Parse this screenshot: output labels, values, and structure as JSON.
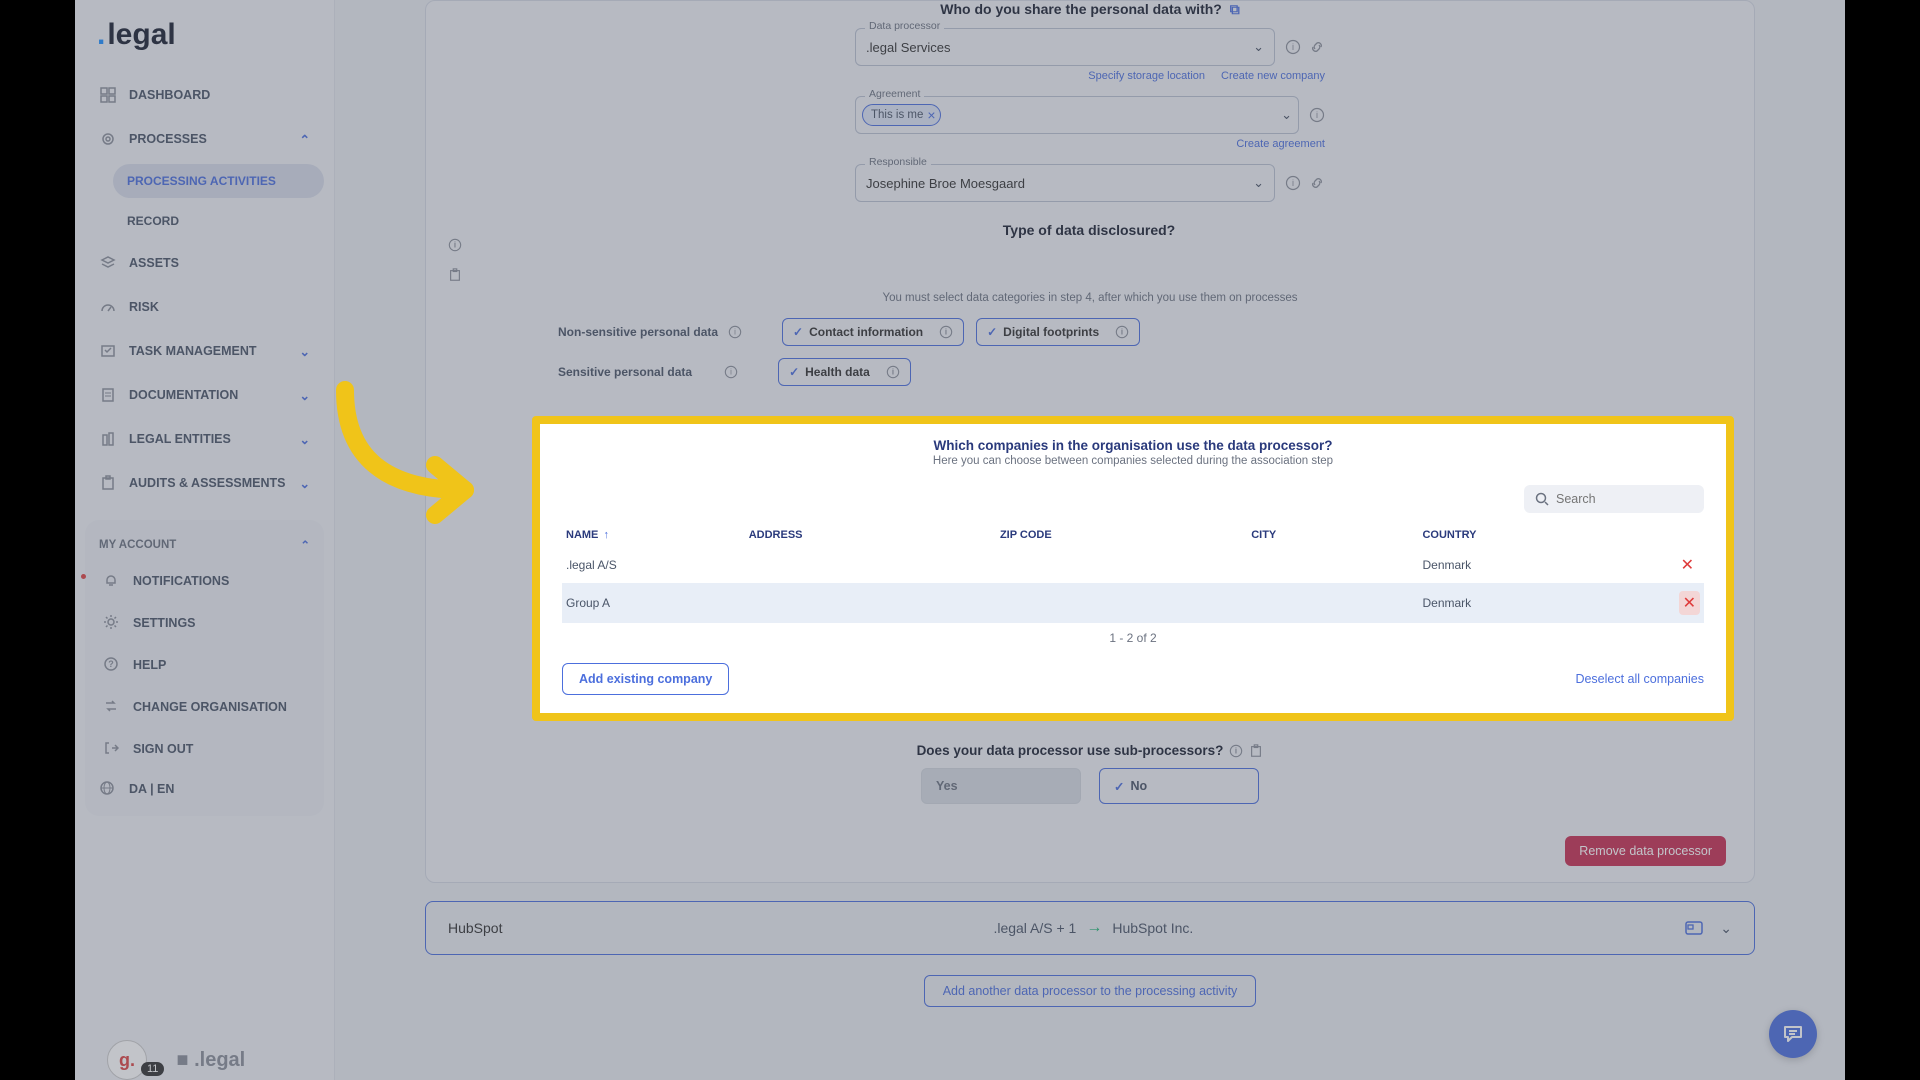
{
  "brand": ".legal",
  "sidebar": {
    "items": [
      {
        "label": "DASHBOARD"
      },
      {
        "label": "PROCESSES"
      },
      {
        "label": "ASSETS"
      },
      {
        "label": "RISK"
      },
      {
        "label": "TASK MANAGEMENT"
      },
      {
        "label": "DOCUMENTATION"
      },
      {
        "label": "LEGAL ENTITIES"
      },
      {
        "label": "AUDITS & ASSESSMENTS"
      }
    ],
    "sub_processes": [
      {
        "label": "PROCESSING ACTIVITIES"
      },
      {
        "label": "RECORD"
      }
    ],
    "account_label": "MY ACCOUNT",
    "account": [
      {
        "label": "NOTIFICATIONS"
      },
      {
        "label": "SETTINGS"
      },
      {
        "label": "HELP"
      },
      {
        "label": "CHANGE ORGANISATION"
      },
      {
        "label": "SIGN OUT"
      }
    ],
    "lang": "DA   |   EN"
  },
  "form": {
    "share_title": "Who do you share the personal data with?",
    "data_processor_label": "Data processor",
    "data_processor_value": ".legal Services",
    "link_storage": "Specify storage location",
    "link_create_company": "Create new company",
    "agreement_label": "Agreement",
    "agreement_tag": "This is me",
    "link_create_agreement": "Create agreement",
    "responsible_label": "Responsible",
    "responsible_value": "Josephine Broe Moesgaard",
    "type_title": "Type of data disclosured?",
    "type_help": "You must select data categories in step 4, after which you use them on processes",
    "nonsens_label": "Non-sensitive personal data",
    "chip_contact": "Contact information",
    "chip_digital": "Digital footprints",
    "sens_label": "Sensitive personal data",
    "chip_health": "Health data",
    "sub_q": "Does your data processor use sub-processors?",
    "yes": "Yes",
    "no": "No",
    "remove": "Remove data processor"
  },
  "panel": {
    "title": "Which companies in the organisation use the data processor?",
    "subtitle": "Here you can choose between companies selected during the association step",
    "search_placeholder": "Search",
    "cols": {
      "name": "NAME",
      "address": "ADDRESS",
      "zip": "ZIP CODE",
      "city": "CITY",
      "country": "COUNTRY"
    },
    "rows": [
      {
        "name": ".legal A/S",
        "address": "",
        "zip": "",
        "city": "",
        "country": "Denmark"
      },
      {
        "name": "Group A",
        "address": "",
        "zip": "",
        "city": "",
        "country": "Denmark"
      }
    ],
    "paging": "1 - 2 of 2",
    "add_btn": "Add existing company",
    "deselect": "Deselect all companies"
  },
  "hubspot": {
    "name": "HubSpot",
    "left": ".legal A/S + 1",
    "right": "HubSpot Inc."
  },
  "add_another": "Add another data processor to the processing activity",
  "badge_count": "11",
  "footer_brand": ".legal"
}
